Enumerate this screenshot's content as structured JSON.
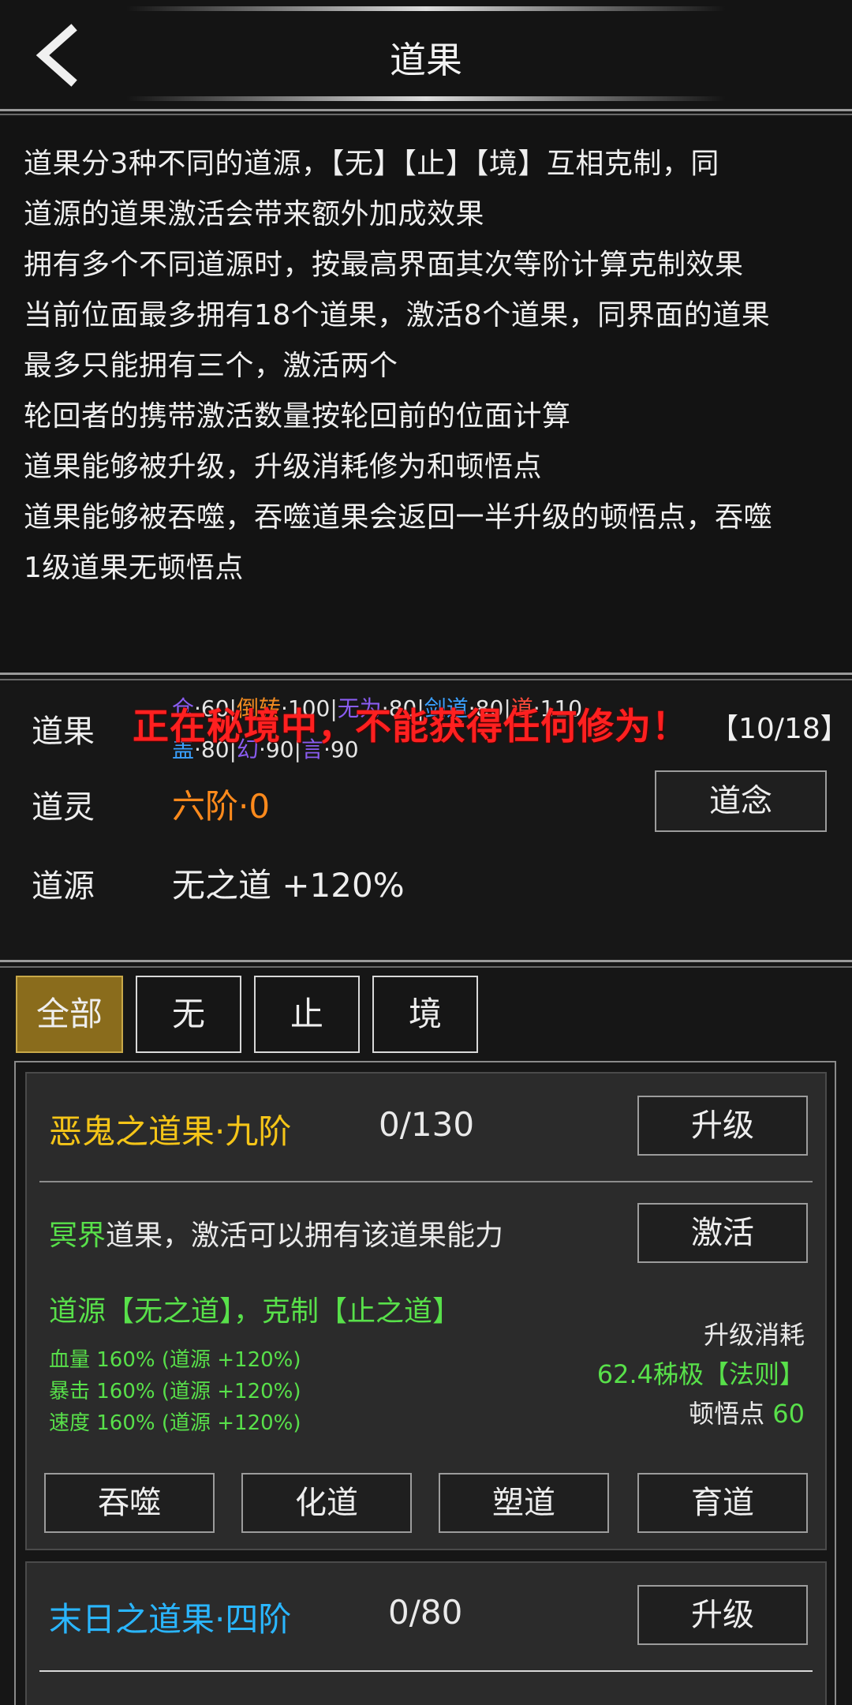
{
  "header": {
    "title": "道果",
    "back_icon": "chevron-left-icon"
  },
  "description": {
    "lines": [
      "道果分3种不同的道源，【无】【止】【境】互相克制，同",
      "道源的道果激活会带来额外加成效果",
      "拥有多个不同道源时，按最高界面其次等阶计算克制效果",
      "当前位面最多拥有18个道果，激活8个道果，同界面的道果",
      "最多只能拥有三个，激活两个",
      "轮回者的携带激活数量按轮回前的位面计算",
      "道果能够被升级，升级消耗修为和顿悟点",
      "道果能够被吞噬，吞噬道果会返回一半升级的顿悟点，吞噬",
      "1级道果无顿悟点"
    ]
  },
  "info": {
    "dao_label": "道果",
    "dao_chips_row1": [
      {
        "name": "仓",
        "sep": "·",
        "value": "60",
        "color": "#8a5cf0"
      },
      {
        "name": "倒转",
        "sep": "·",
        "value": "100",
        "color": "#f08a20"
      },
      {
        "name": "无为",
        "sep": "·",
        "value": "80",
        "color": "#8a5cf0"
      },
      {
        "name": "剑道",
        "sep": "·",
        "value": "80",
        "color": "#3aa0ff"
      },
      {
        "name": "道",
        "sep": "·",
        "value": "110",
        "color": "#ff4a3a"
      }
    ],
    "dao_chips_row2": [
      {
        "name": "盖",
        "sep": "·",
        "value": "80",
        "color": "#3aa0ff"
      },
      {
        "name": "幻",
        "sep": "·",
        "value": "90",
        "color": "#8a5cf0"
      },
      {
        "name": "言",
        "sep": "·",
        "value": "90",
        "color": "#8a5cf0"
      }
    ],
    "dao_count": "【10/18】",
    "alert": "正在秘境中，不能获得任何修为！",
    "ling_label": "道灵",
    "ling_value": "六阶·0",
    "ling_color": "#ff8a1c",
    "nian_button": "道念",
    "yuan_label": "道源",
    "yuan_value": "无之道 +120%"
  },
  "tabs": [
    {
      "label": "全部",
      "active": true
    },
    {
      "label": "无",
      "active": false
    },
    {
      "label": "止",
      "active": false
    },
    {
      "label": "境",
      "active": false
    }
  ],
  "cards": [
    {
      "title": "恶鬼之道果·九阶",
      "title_color": "#f5c518",
      "progress": "0/130",
      "upgrade_button": "升级",
      "realm": "冥界",
      "realm_desc": "道果，激活可以拥有该道果能力",
      "activate_button": "激活",
      "source_text": "道源【无之道】，克制【止之道】",
      "stats": [
        "血量 160% (道源 +120%)",
        "暴击 160% (道源 +120%)",
        "速度 160% (道源 +120%)"
      ],
      "cost_label": "升级消耗",
      "cost_value": "62.4秭极【法则】",
      "insight_label": "顿悟点",
      "insight_value": "60",
      "actions": [
        "吞噬",
        "化道",
        "塑道",
        "育道"
      ]
    },
    {
      "title": "末日之道果·四阶",
      "title_color": "#2ab6ff",
      "progress": "0/80",
      "upgrade_button": "升级"
    }
  ]
}
